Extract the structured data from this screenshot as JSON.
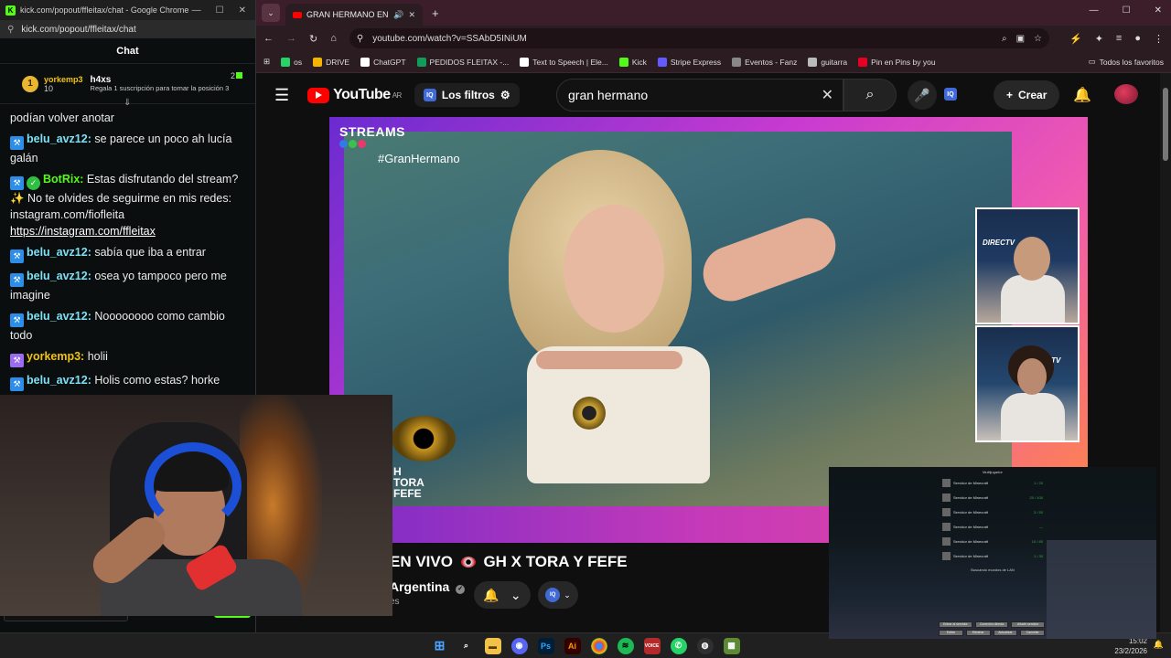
{
  "kick_window": {
    "title": "kick.com/popout/ffleitax/chat - Google Chrome",
    "url": "kick.com/popout/ffleitax/chat",
    "chat_header": "Chat",
    "pinned": {
      "rank_number": "1",
      "top_user": "yorkemp3",
      "top_count": "10",
      "gift_user": "h4xs",
      "gift_count": "2",
      "gift_message": "Regala 1 suscripción para tomar la posición 3"
    },
    "messages": [
      {
        "user": "",
        "text": "podían volver anotar",
        "color": "#ffffff"
      },
      {
        "user": "belu_avz12:",
        "text": " se parece un poco ah lucía galán",
        "color": "#7ee0f5"
      },
      {
        "user": "BotRix:",
        "text": " Estas disfrutando del stream? ✨ No te olvides de seguirme en mis redes: instagram.com/fiofleita",
        "color": "#53fc18"
      },
      {
        "user": "",
        "text": "https://instagram.com/ffleitax",
        "color": "#ffffff"
      },
      {
        "user": "belu_avz12:",
        "text": " sabía que iba a entrar",
        "color": "#7ee0f5"
      },
      {
        "user": "belu_avz12:",
        "text": " osea yo tampoco pero me imagine",
        "color": "#7ee0f5"
      },
      {
        "user": "belu_avz12:",
        "text": " Noooooooo como cambio todo",
        "color": "#7ee0f5"
      },
      {
        "user": "yorkemp3:",
        "text": " holii",
        "color": "#f1c40f"
      },
      {
        "user": "belu_avz12:",
        "text": " Holis como estas? horke",
        "color": "#7ee0f5"
      }
    ]
  },
  "chrome": {
    "tab_title": "GRAN HERMANO EN VIVO",
    "url": "youtube.com/watch?v=SSAbD5INiUM",
    "bookmarks": [
      {
        "label": "os",
        "color": "#25d366"
      },
      {
        "label": "DRIVE",
        "color": "#f4b400"
      },
      {
        "label": "ChatGPT",
        "color": "#ffffff"
      },
      {
        "label": "PEDIDOS FLEITAX -...",
        "color": "#0f9d58"
      },
      {
        "label": "Text to Speech | Ele...",
        "color": "#ffffff"
      },
      {
        "label": "Kick",
        "color": "#53fc18"
      },
      {
        "label": "Stripe Express",
        "color": "#635bff"
      },
      {
        "label": "Eventos - Fanz",
        "color": "#888888"
      },
      {
        "label": "guitarra",
        "color": "#bbbbbb"
      },
      {
        "label": "Pin en Pins by you",
        "color": "#e60023"
      }
    ],
    "all_bookmarks": "Todos los favoritos"
  },
  "youtube": {
    "logo_text": "YouTube",
    "country": "AR",
    "filters_label": "Los filtros",
    "search_value": "gran hermano",
    "create_label": "Crear",
    "streams_label": "STREAMS",
    "hashtag": "#GranHermano",
    "pip_brand": "DIRECTV",
    "pip_brand_partial": "ECTV",
    "gh_text": "H\nTORA\nFEFE",
    "video_title": "EN VIVO",
    "video_title_rest": "GH X TORA Y FEFE",
    "channel": "Argentina",
    "subs": "es"
  },
  "game_overlay": {
    "title": "Multijugador",
    "servers": [
      {
        "name": "Servidor de Minecraft",
        "status": "1 / 20"
      },
      {
        "name": "Servidor de Minecraft",
        "status": "20 / 100"
      },
      {
        "name": "Servidor de Minecraft",
        "status": "3 / 50"
      },
      {
        "name": "Servidor de Minecraft",
        "status": "—"
      },
      {
        "name": "Servidor de Minecraft",
        "status": "10 / 80"
      },
      {
        "name": "Servidor de Minecraft",
        "status": "1 / 30"
      }
    ],
    "scanning": "Buscando mundos de LAN",
    "buttons_row1": [
      "Entrar al servidor",
      "Conexión directa",
      "Añadir servidor"
    ],
    "buttons_row2": [
      "Editar",
      "Eliminar",
      "Actualizar",
      "Cancelar"
    ]
  },
  "taskbar": {
    "time": "15:02",
    "date": "23/2/2026"
  }
}
